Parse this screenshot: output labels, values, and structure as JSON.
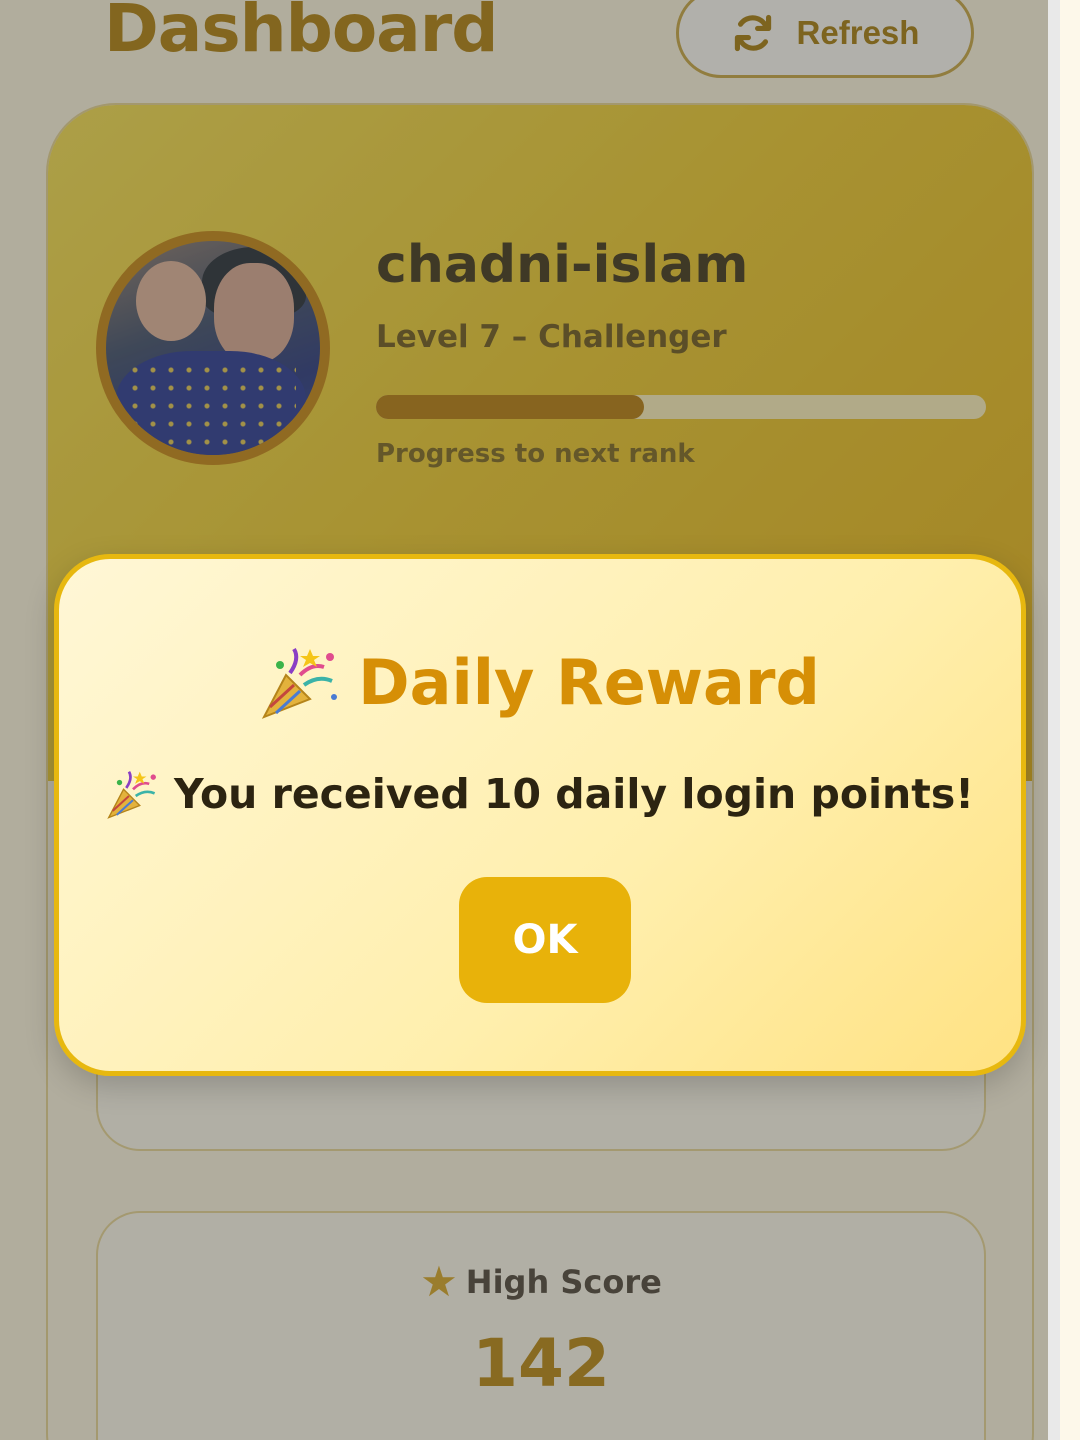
{
  "header": {
    "title": "Dashboard",
    "refresh_label": "Refresh"
  },
  "profile": {
    "username": "chadni-islam",
    "level_text": "Level 7 – Challenger",
    "progress_fraction": 0.44,
    "progress_label": "Progress to next rank"
  },
  "stats": {
    "high_score_label": "High Score",
    "high_score_value": "142"
  },
  "modal": {
    "title": "Daily Reward",
    "message": "You received 10 daily login points!",
    "ok_label": "OK"
  },
  "colors": {
    "accent": "#e8b20a",
    "title_text": "#b07f05",
    "progress_fill": "#b77a05"
  },
  "icons": {
    "refresh": "refresh-icon",
    "star": "star-icon",
    "party_popper": "party-popper-icon"
  }
}
